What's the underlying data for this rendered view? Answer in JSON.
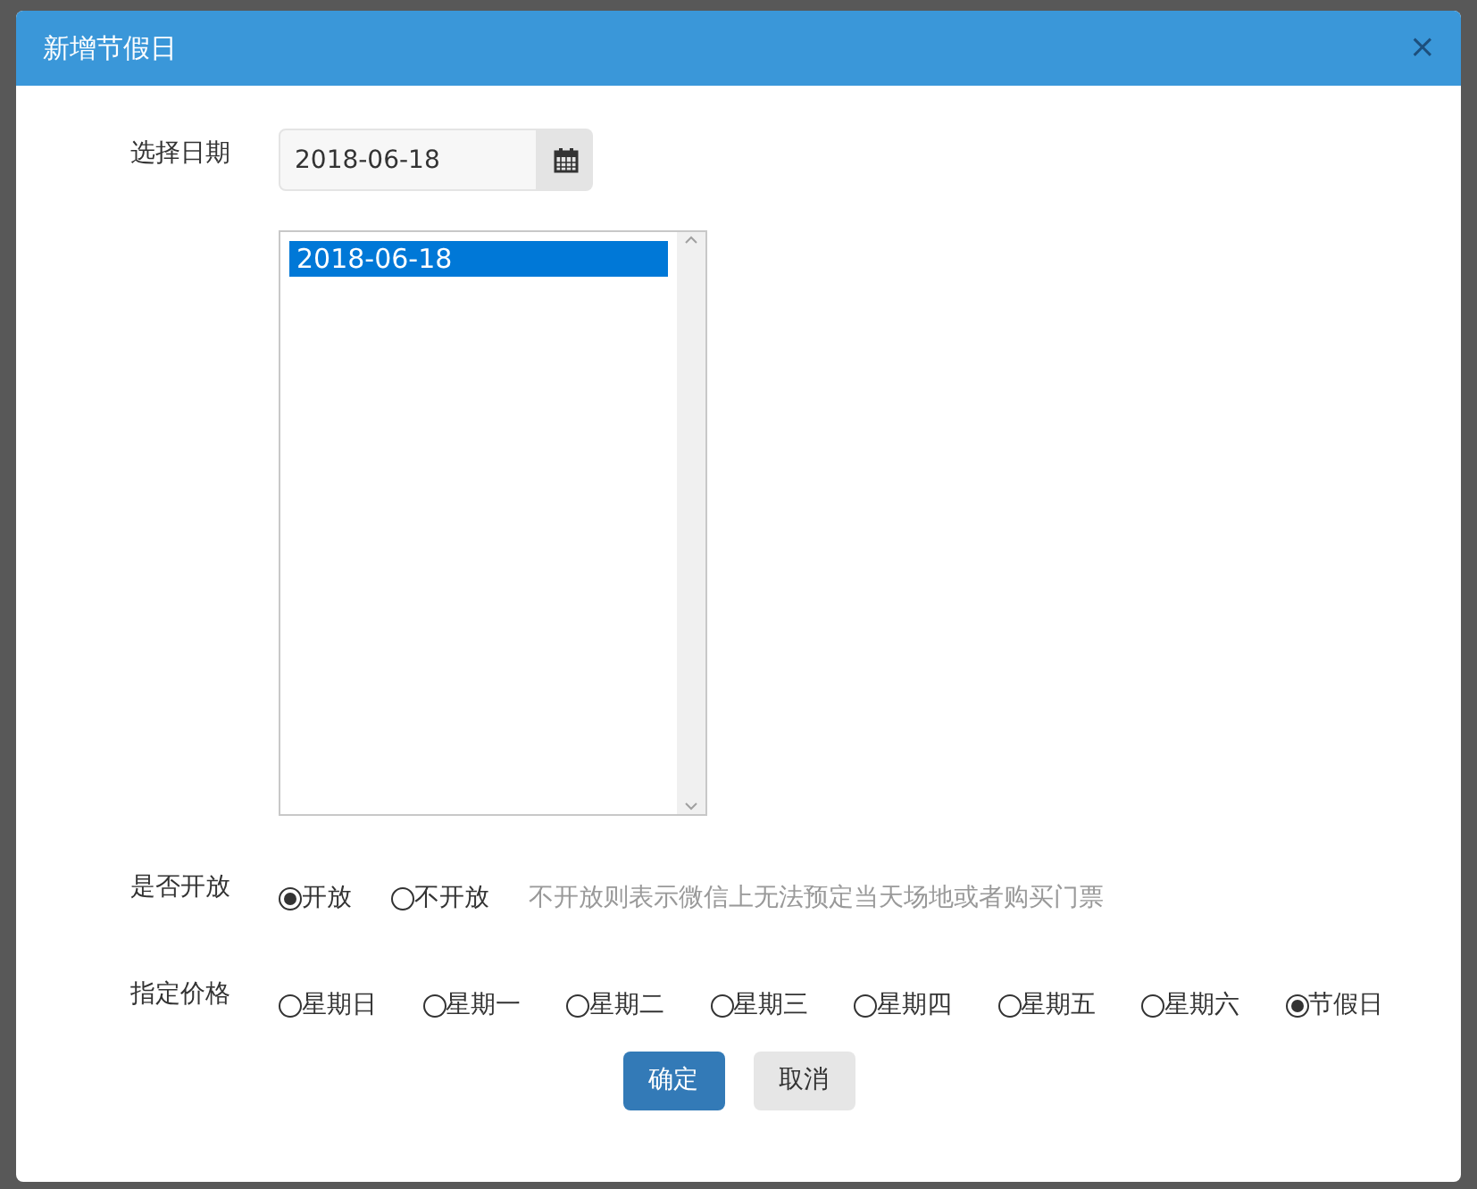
{
  "dialog": {
    "title": "新增节假日",
    "close": "×"
  },
  "date": {
    "label": "选择日期",
    "value": "2018-06-18"
  },
  "date_list": {
    "items": [
      {
        "text": "2018-06-18",
        "selected": true
      }
    ]
  },
  "open": {
    "label": "是否开放",
    "options": [
      {
        "text": "开放",
        "selected": true
      },
      {
        "text": "不开放",
        "selected": false
      }
    ],
    "hint": "不开放则表示微信上无法预定当天场地或者购买门票"
  },
  "price": {
    "label": "指定价格",
    "options": [
      {
        "text": "星期日",
        "selected": false
      },
      {
        "text": "星期一",
        "selected": false
      },
      {
        "text": "星期二",
        "selected": false
      },
      {
        "text": "星期三",
        "selected": false
      },
      {
        "text": "星期四",
        "selected": false
      },
      {
        "text": "星期五",
        "selected": false
      },
      {
        "text": "星期六",
        "selected": false
      },
      {
        "text": "节假日",
        "selected": true
      }
    ]
  },
  "buttons": [
    {
      "text": "确定",
      "kind": "primary"
    },
    {
      "text": "取消",
      "kind": "default"
    }
  ]
}
